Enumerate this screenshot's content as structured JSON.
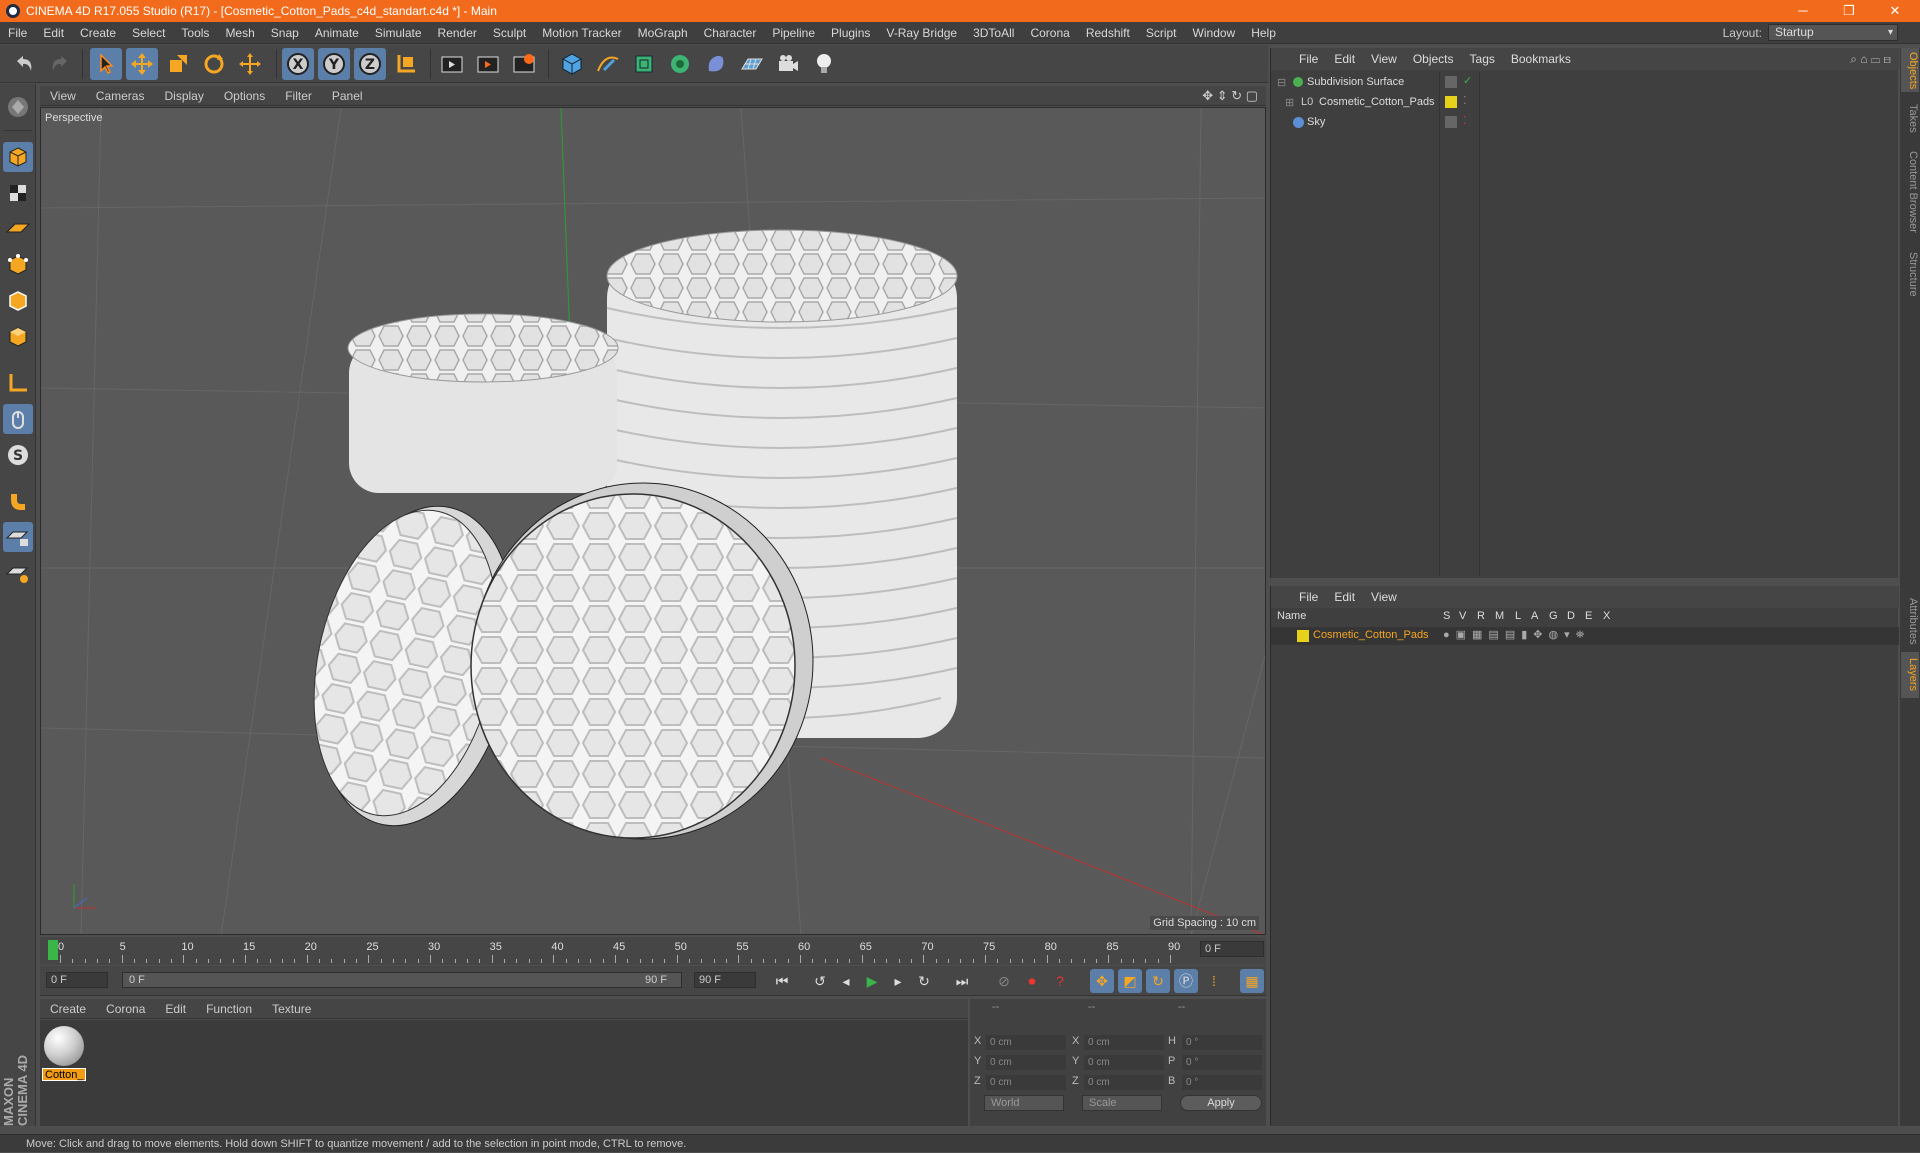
{
  "window": {
    "title": "CINEMA 4D R17.055 Studio (R17) - [Cosmetic_Cotton_Pads_c4d_standart.c4d *] - Main",
    "minimize_glyph": "─",
    "maximize_glyph": "❐",
    "close_glyph": "✕"
  },
  "menubar": [
    "File",
    "Edit",
    "Create",
    "Select",
    "Tools",
    "Mesh",
    "Snap",
    "Animate",
    "Simulate",
    "Render",
    "Sculpt",
    "Motion Tracker",
    "MoGraph",
    "Character",
    "Pipeline",
    "Plugins",
    "V-Ray Bridge",
    "3DToAll",
    "Corona",
    "Redshift",
    "Script",
    "Window",
    "Help"
  ],
  "layout": {
    "label": "Layout:",
    "value": "Startup"
  },
  "viewport": {
    "menu": [
      "View",
      "Cameras",
      "Display",
      "Options",
      "Filter",
      "Panel"
    ],
    "camera_label": "Perspective",
    "grid_spacing": "Grid Spacing : 10 cm"
  },
  "timeline": {
    "ticks": [
      "0",
      "5",
      "10",
      "15",
      "20",
      "25",
      "30",
      "35",
      "40",
      "45",
      "50",
      "55",
      "60",
      "65",
      "70",
      "75",
      "80",
      "85",
      "90"
    ],
    "current_frame": "0 F"
  },
  "transport": {
    "start_field": "0 F",
    "slider_start": "0 F",
    "slider_end": "90 F",
    "end_field": "90 F"
  },
  "material_manager": {
    "menu": [
      "Create",
      "Corona",
      "Edit",
      "Function",
      "Texture"
    ],
    "materials": [
      {
        "name": "Cotton_"
      }
    ]
  },
  "coordinates": {
    "headers": [
      "--",
      "--",
      "--"
    ],
    "rows": [
      {
        "a1": "X",
        "v1": "0 cm",
        "a2": "X",
        "v2": "0 cm",
        "a3": "H",
        "v3": "0 °"
      },
      {
        "a1": "Y",
        "v1": "0 cm",
        "a2": "Y",
        "v2": "0 cm",
        "a3": "P",
        "v3": "0 °"
      },
      {
        "a1": "Z",
        "v1": "0 cm",
        "a2": "Z",
        "v2": "0 cm",
        "a3": "B",
        "v3": "0 °"
      }
    ],
    "space_select": "World",
    "mode_select": "Scale",
    "apply_label": "Apply"
  },
  "object_manager": {
    "menu": [
      "File",
      "Edit",
      "View",
      "Objects",
      "Tags",
      "Bookmarks"
    ],
    "objects": [
      {
        "name": "Subdivision Surface",
        "color": "#4caf50"
      },
      {
        "name": "Cosmetic_Cotton_Pads",
        "color": "#e6d21a"
      },
      {
        "name": "Sky",
        "color": "#5c8fd6"
      }
    ]
  },
  "layer_manager": {
    "menu": [
      "File",
      "Edit",
      "View"
    ],
    "columns": [
      "Name",
      "S",
      "V",
      "R",
      "M",
      "L",
      "A",
      "G",
      "D",
      "E",
      "X"
    ],
    "layers": [
      {
        "name": "Cosmetic_Cotton_Pads",
        "color": "#e6d21a"
      }
    ]
  },
  "right_tabs": [
    "Objects",
    "Takes",
    "Content Browser",
    "Structure",
    "Attributes",
    "Layers"
  ],
  "maxon_logo": "MAXON CINEMA 4D",
  "status": "Move: Click and drag to move elements. Hold down SHIFT to quantize movement / add to the selection in point mode, CTRL to remove.",
  "colors": {
    "title_bar": "#f26b1d",
    "accent": "#5b7fa8",
    "material_label": "#f39c12"
  }
}
